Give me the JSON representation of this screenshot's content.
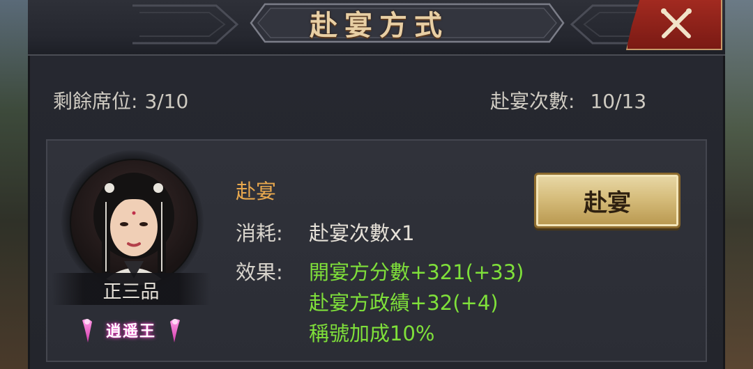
{
  "dialog": {
    "title": "赴宴方式",
    "close_icon": "close-x-icon"
  },
  "stats": {
    "remaining_seats_label": "剩餘席位:",
    "remaining_seats_value": "3/10",
    "attend_count_label": "赴宴次數:",
    "attend_count_value": "10/13"
  },
  "option": {
    "portrait_icon": "character-portrait",
    "rank": "正三品",
    "title_badge": "逍遥王",
    "name": "赴宴",
    "cost_label": "消耗:",
    "cost_value": "赴宴次數x1",
    "effect_label": "效果:",
    "effects": [
      "開宴方分數+321(+33)",
      "赴宴方政績+32(+4)",
      "稱號加成10%"
    ],
    "button_label": "赴宴"
  },
  "colors": {
    "title_gold": "#e8cfa4",
    "option_title": "#e8a84e",
    "effect_green": "#7fe03a",
    "close_red": "#a22a20",
    "button_gold": "#d6bd7c"
  }
}
